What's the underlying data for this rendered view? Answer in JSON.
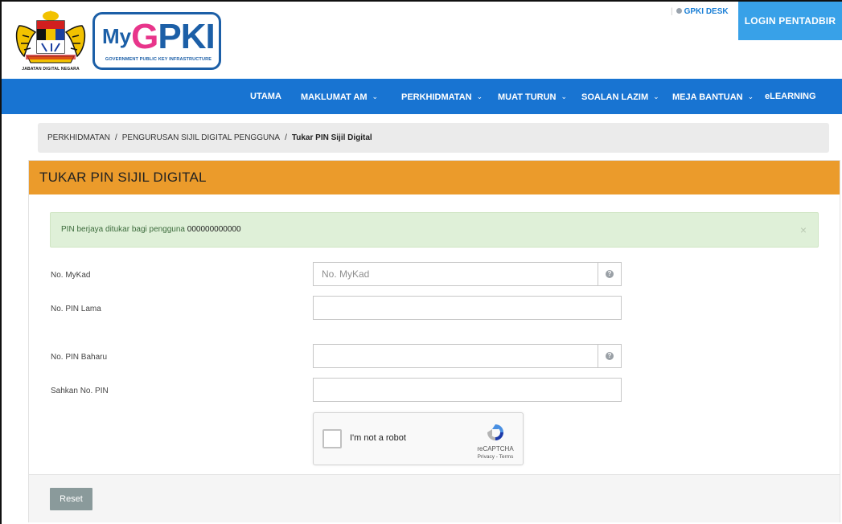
{
  "header": {
    "crest_caption": "JABATAN DIGITAL NEGARA",
    "logo": {
      "my": "My",
      "g": "G",
      "pki": "PKI",
      "subtitle": "GOVERNMENT PUBLIC KEY INFRASTRUCTURE"
    },
    "gpki_desk": "GPKI DESK",
    "login_label": "LOGIN PENTADBIR"
  },
  "nav": {
    "items": [
      {
        "label": "UTAMA",
        "has_dropdown": false
      },
      {
        "label": "MAKLUMAT AM",
        "has_dropdown": true
      },
      {
        "label": "PERKHIDMATAN",
        "has_dropdown": true
      },
      {
        "label": "MUAT TURUN",
        "has_dropdown": true
      },
      {
        "label": "SOALAN LAZIM",
        "has_dropdown": true
      },
      {
        "label": "MEJA BANTUAN",
        "has_dropdown": true
      },
      {
        "label": "eLEARNING",
        "has_dropdown": false
      }
    ]
  },
  "breadcrumb": {
    "items": [
      "PERKHIDMATAN",
      "PENGURUSAN SIJIL DIGITAL PENGGUNA"
    ],
    "current": "Tukar PIN Sijil Digital"
  },
  "panel": {
    "title": "TUKAR PIN SIJIL DIGITAL",
    "alert": {
      "message": "PIN berjaya ditukar bagi pengguna ",
      "user_id": "000000000000",
      "close": "×"
    },
    "fields": {
      "mykad": {
        "label": "No. MyKad",
        "placeholder": "No. MyKad",
        "value": ""
      },
      "pin_lama": {
        "label": "No. PIN Lama",
        "value": ""
      },
      "pin_baharu": {
        "label": "No. PIN Baharu",
        "value": ""
      },
      "sahkan_pin": {
        "label": "Sahkan No. PIN",
        "value": ""
      }
    },
    "recaptcha": {
      "text": "I'm not a robot",
      "brand": "reCAPTCHA",
      "links": "Privacy - Terms"
    },
    "reset_label": "Reset"
  },
  "colors": {
    "nav_bg": "#1874d2",
    "login_bg": "#38a1e8",
    "panel_header": "#eb9b2b",
    "alert_bg": "#dff0d8",
    "reset_bg": "#8a9a9b"
  }
}
